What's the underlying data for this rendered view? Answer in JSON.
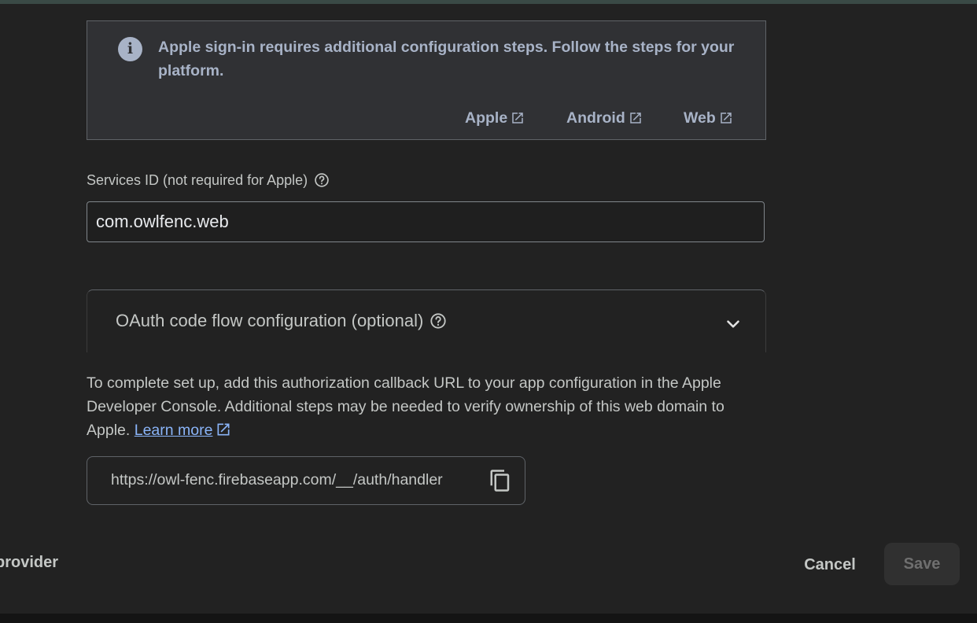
{
  "info": {
    "icon": "info-icon",
    "message": "Apple sign-in requires additional configuration steps. Follow the steps for your platform.",
    "links": [
      {
        "label": "Apple",
        "icon": "open-in-new-icon"
      },
      {
        "label": "Android",
        "icon": "open-in-new-icon"
      },
      {
        "label": "Web",
        "icon": "open-in-new-icon"
      }
    ]
  },
  "services_id": {
    "label": "Services ID (not required for Apple)",
    "value": "com.owlfenc.web"
  },
  "oauth": {
    "title": "OAuth code flow configuration (optional)",
    "expanded": false
  },
  "callback": {
    "description": "To complete set up, add this authorization callback URL to your app configuration in the Apple Developer Console. Additional steps may be needed to verify ownership of this web domain to Apple.",
    "learn_more": "Learn more",
    "url": "https://owl-fenc.firebaseapp.com/__/auth/handler"
  },
  "footer": {
    "provider_text": "provider",
    "cancel_label": "Cancel",
    "save_label": "Save"
  },
  "colors": {
    "background": "#222222",
    "info_text": "#a8b3c7",
    "link": "#8ab4f8",
    "border": "#5f6368"
  }
}
